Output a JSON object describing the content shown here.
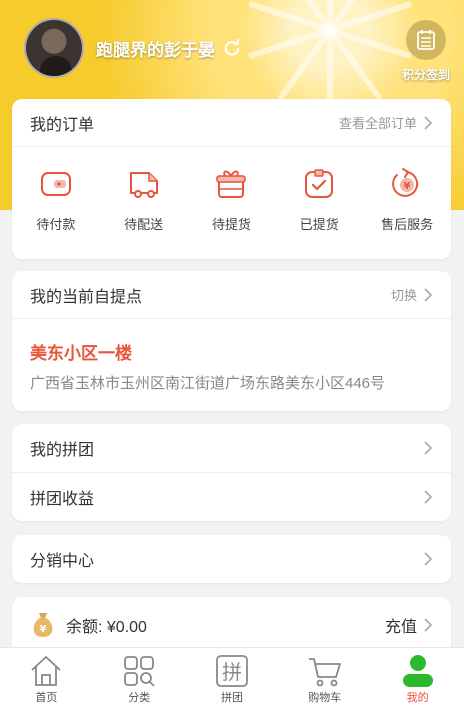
{
  "profile": {
    "username": "跑腿界的彭于晏",
    "checkin_label": "积分签到"
  },
  "orders": {
    "title": "我的订单",
    "view_all": "查看全部订单",
    "items": [
      {
        "label": "待付款",
        "icon": "wallet-icon"
      },
      {
        "label": "待配送",
        "icon": "delivery-truck-icon"
      },
      {
        "label": "待提货",
        "icon": "gift-box-icon"
      },
      {
        "label": "已提货",
        "icon": "received-package-icon"
      },
      {
        "label": "售后服务",
        "icon": "after-sales-icon"
      }
    ]
  },
  "pickup": {
    "title": "我的当前自提点",
    "switch_label": "切换",
    "name": "美东小区一楼",
    "address": "广西省玉林市玉州区南江街道广场东路美东小区446号"
  },
  "group": {
    "my_group": "我的拼团",
    "group_income": "拼团收益"
  },
  "distribution": {
    "label": "分销中心"
  },
  "balance": {
    "label": "余额: ¥0.00",
    "recharge": "充值"
  },
  "tabbar": {
    "items": [
      {
        "label": "首页",
        "icon": "home-icon"
      },
      {
        "label": "分类",
        "icon": "category-icon"
      },
      {
        "label": "拼团",
        "icon": "group-buy-icon"
      },
      {
        "label": "购物车",
        "icon": "cart-icon"
      },
      {
        "label": "我的",
        "icon": "profile-icon"
      }
    ],
    "active_index": 4
  },
  "colors": {
    "accent": "#e8543c",
    "active_tab": "#2eb82e",
    "header": "#f6cb2c"
  }
}
